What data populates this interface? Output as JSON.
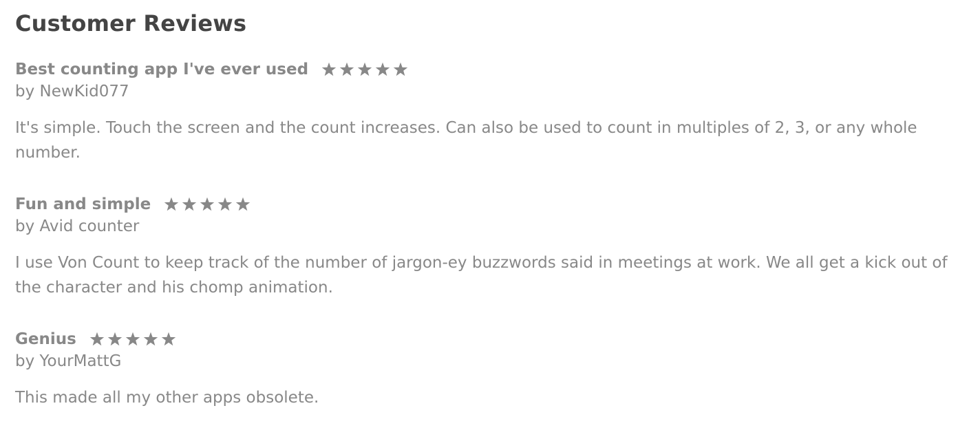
{
  "section": {
    "title": "Customer Reviews"
  },
  "colors": {
    "heading": "#444444",
    "text": "#888888",
    "star": "#888888"
  },
  "reviews": [
    {
      "title": "Best counting app I've ever used",
      "rating": 5,
      "max_rating": 5,
      "author": "by NewKid077",
      "body": "It's simple. Touch the screen and the count increases. Can also be used to count in multiples of 2, 3, or any whole number."
    },
    {
      "title": "Fun and simple",
      "rating": 5,
      "max_rating": 5,
      "author": "by Avid counter",
      "body": "I use Von Count to keep track of the number of jargon-ey buzzwords said in meetings at work. We all get a kick out of the character and his chomp animation."
    },
    {
      "title": "Genius",
      "rating": 5,
      "max_rating": 5,
      "author": "by YourMattG",
      "body": "This made all my other apps obsolete."
    }
  ]
}
